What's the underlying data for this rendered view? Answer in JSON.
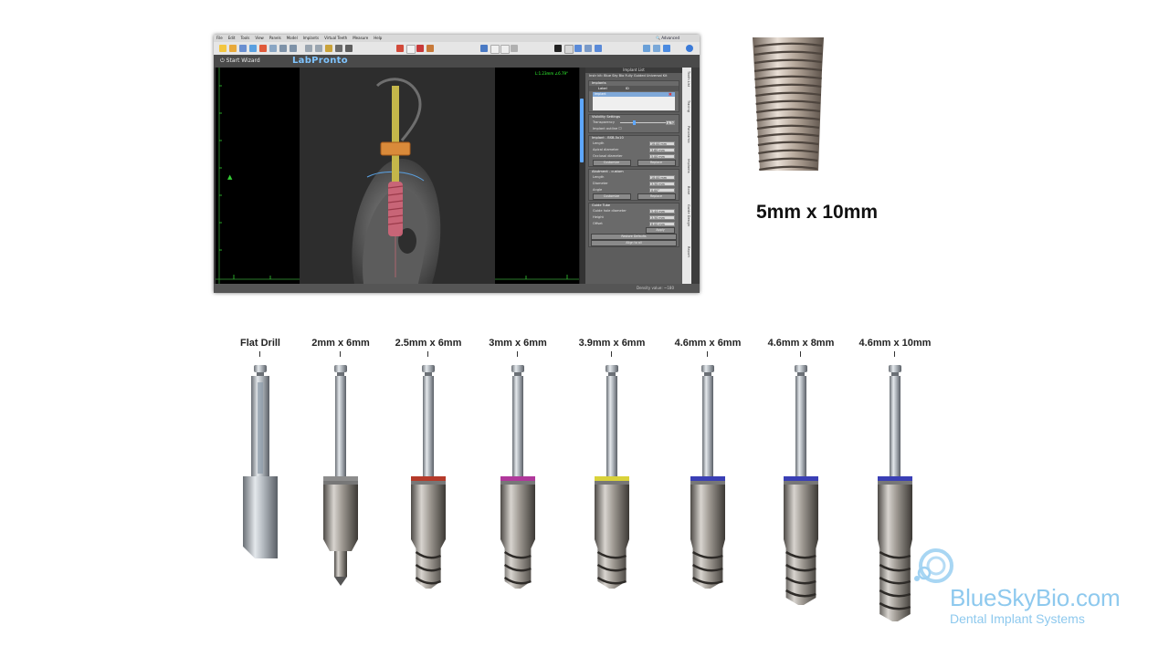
{
  "app": {
    "menu": [
      "File",
      "Edit",
      "Tools",
      "View",
      "Panels",
      "Model",
      "Implants",
      "Virtual Teeth",
      "Measure",
      "Help"
    ],
    "search_label": "Advanced",
    "wizard_label": "Start Wizard",
    "logo": "LabPronto",
    "coord_readout": "L:1.23mm ∠6.79°",
    "status": "Density value: ~180"
  },
  "panel": {
    "title": "Implant List",
    "subtitle": "Instr kit:    Blue Sky Bio Fully Guided Universal Kit",
    "implants_header": "Implants",
    "list_headers": [
      "Label",
      "ID"
    ],
    "list_row": "Implant",
    "visibility_header": "Visibility Settings",
    "transparency_label": "Transparency",
    "transparency_value": "0.70",
    "implant_outline_label": "Implant outline",
    "implant_header": "Implant - BSB-5x10",
    "implant_fields": [
      {
        "label": "Length",
        "value": "10.00 mm"
      },
      {
        "label": "Apical diameter",
        "value": "3.60 mm"
      },
      {
        "label": "Occlusal diameter",
        "value": "5.00 mm"
      }
    ],
    "customize_label": "Customize",
    "replace_label": "Replace",
    "abutment_header": "Abutment - custom",
    "abutment_fields": [
      {
        "label": "Length",
        "value": "10.00 mm"
      },
      {
        "label": "Diameter",
        "value": "3.50 mm"
      },
      {
        "label": "Angle",
        "value": "0.00°"
      }
    ],
    "guide_header": "Guide Tube",
    "guide_fields": [
      {
        "label": "Guide hole diameter",
        "value": "5.44 mm"
      },
      {
        "label": "Height",
        "value": "3.50 mm"
      },
      {
        "label": "Offset",
        "value": "8.00 mm"
      }
    ],
    "apply_label": "Apply",
    "restore_label": "Restore Defaults",
    "align_label": "Align to all",
    "side_tabs": [
      "Tooth List",
      "Tracing",
      "Panoramic",
      "Implants",
      "Bone",
      "Guide Design",
      "Report"
    ]
  },
  "implant_caption": "5mm x 10mm",
  "drills": [
    {
      "label": "Flat Drill",
      "band": "#6d7f8c",
      "style": "flat",
      "tip": 1.0
    },
    {
      "label": "2mm x 6mm",
      "band": "#8c8c8c",
      "style": "pilot",
      "tip": 0.0
    },
    {
      "label": "2.5mm x 6mm",
      "band": "#b53a2a",
      "style": "twist",
      "tip": 0.2
    },
    {
      "label": "3mm x 6mm",
      "band": "#b0389b",
      "style": "twist",
      "tip": 0.3
    },
    {
      "label": "3.9mm x 6mm",
      "band": "#d9d23a",
      "style": "twist",
      "tip": 0.45
    },
    {
      "label": "4.6mm x 6mm",
      "band": "#3a3fb5",
      "style": "twist",
      "tip": 0.55
    },
    {
      "label": "4.6mm x 8mm",
      "band": "#3a3fb5",
      "style": "long8",
      "tip": 0.55
    },
    {
      "label": "4.6mm x 10mm",
      "band": "#3a3fb5",
      "style": "long10",
      "tip": 0.6
    }
  ],
  "logo": {
    "name": "BlueSkyBio.com",
    "tagline": "Dental Implant Systems"
  }
}
